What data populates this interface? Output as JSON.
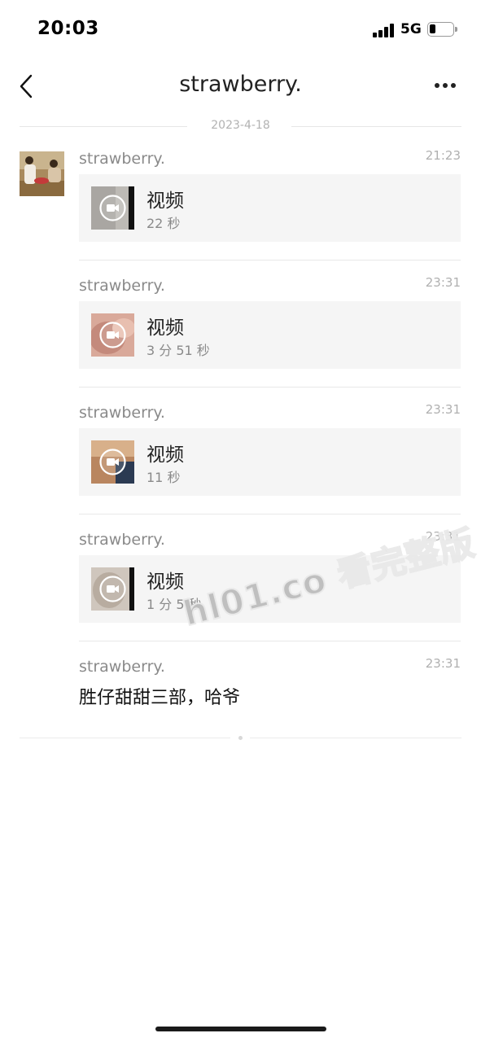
{
  "status_bar": {
    "time": "20:03",
    "network": "5G"
  },
  "nav": {
    "title": "strawberry."
  },
  "date_divider": "2023-4-18",
  "messages": [
    {
      "sender": "strawberry.",
      "time": "21:23",
      "type": "video",
      "title": "视频",
      "duration": "22 秒"
    },
    {
      "sender": "strawberry.",
      "time": "23:31",
      "type": "video",
      "title": "视频",
      "duration": "3 分 51 秒"
    },
    {
      "sender": "strawberry.",
      "time": "23:31",
      "type": "video",
      "title": "视频",
      "duration": "11 秒"
    },
    {
      "sender": "strawberry.",
      "time": "23:31",
      "type": "video",
      "title": "视频",
      "duration": "1 分 5 秒"
    },
    {
      "sender": "strawberry.",
      "time": "23:31",
      "type": "text",
      "text": "胜仔甜甜三部，哈爷"
    }
  ],
  "watermark": "hl01.co 看完整版",
  "icons": {
    "back": "chevron-left-icon",
    "more": "more-dots-icon",
    "video": "video-camera-icon"
  },
  "colors": {
    "card_bg": "#f5f5f5",
    "secondary_text": "#8a8a8a",
    "timestamp": "#b0b0b0"
  }
}
